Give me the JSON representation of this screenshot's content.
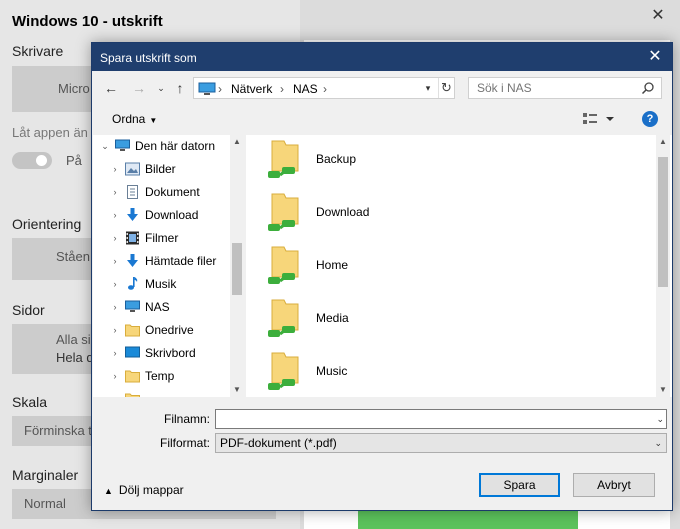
{
  "background_window": {
    "title": "Windows 10 - utskrift",
    "close_glyph": "✕",
    "printer_label": "Skrivare",
    "printer_value": "Micro",
    "allow_label": "Låt appen än",
    "toggle_value": "På",
    "orientation_label": "Orientering",
    "orientation_value": "Ståen",
    "pages_label": "Sidor",
    "pages_line1": "Alla si",
    "pages_line2": "Hela d",
    "scale_label": "Skala",
    "scale_value": "Förminska t",
    "margins_label": "Marginaler",
    "margins_value": "Normal"
  },
  "dialog": {
    "title": "Spara utskrift som",
    "close_glyph": "✕",
    "nav": {
      "back_glyph": "←",
      "forward_glyph": "→",
      "recent_glyph": "⌄",
      "up_glyph": "↑",
      "path": [
        "Nätverk",
        "NAS"
      ],
      "separator": "›",
      "refresh_glyph": "↻",
      "search_placeholder": "Sök i NAS"
    },
    "toolbar": {
      "organize_label": "Ordna",
      "help_glyph": "?"
    },
    "tree": {
      "items": [
        {
          "label": "Den här datorn",
          "icon": "computer-icon",
          "expanded": true
        },
        {
          "label": "Bilder",
          "icon": "pictures-icon"
        },
        {
          "label": "Dokument",
          "icon": "documents-icon"
        },
        {
          "label": "Download",
          "icon": "download-icon"
        },
        {
          "label": "Filmer",
          "icon": "videos-icon"
        },
        {
          "label": "Hämtade filer",
          "icon": "download-icon"
        },
        {
          "label": "Musik",
          "icon": "music-icon"
        },
        {
          "label": "NAS",
          "icon": "network-drive-icon"
        },
        {
          "label": "Onedrive",
          "icon": "folder-icon"
        },
        {
          "label": "Skrivbord",
          "icon": "desktop-icon"
        },
        {
          "label": "Temp",
          "icon": "folder-icon"
        }
      ]
    },
    "folders": [
      "Backup",
      "Download",
      "Home",
      "Media",
      "Music"
    ],
    "filename_label": "Filnamn:",
    "filename_value": "",
    "filetype_label": "Filformat:",
    "filetype_value": "PDF-dokument (*.pdf)",
    "hide_folders_label": "Dölj mappar",
    "save_label": "Spara",
    "cancel_label": "Avbryt"
  },
  "colors": {
    "titlebar": "#1f3e6e",
    "accent": "#0078d7",
    "folder": "#f7d67a",
    "network_green": "#3cae3c"
  }
}
